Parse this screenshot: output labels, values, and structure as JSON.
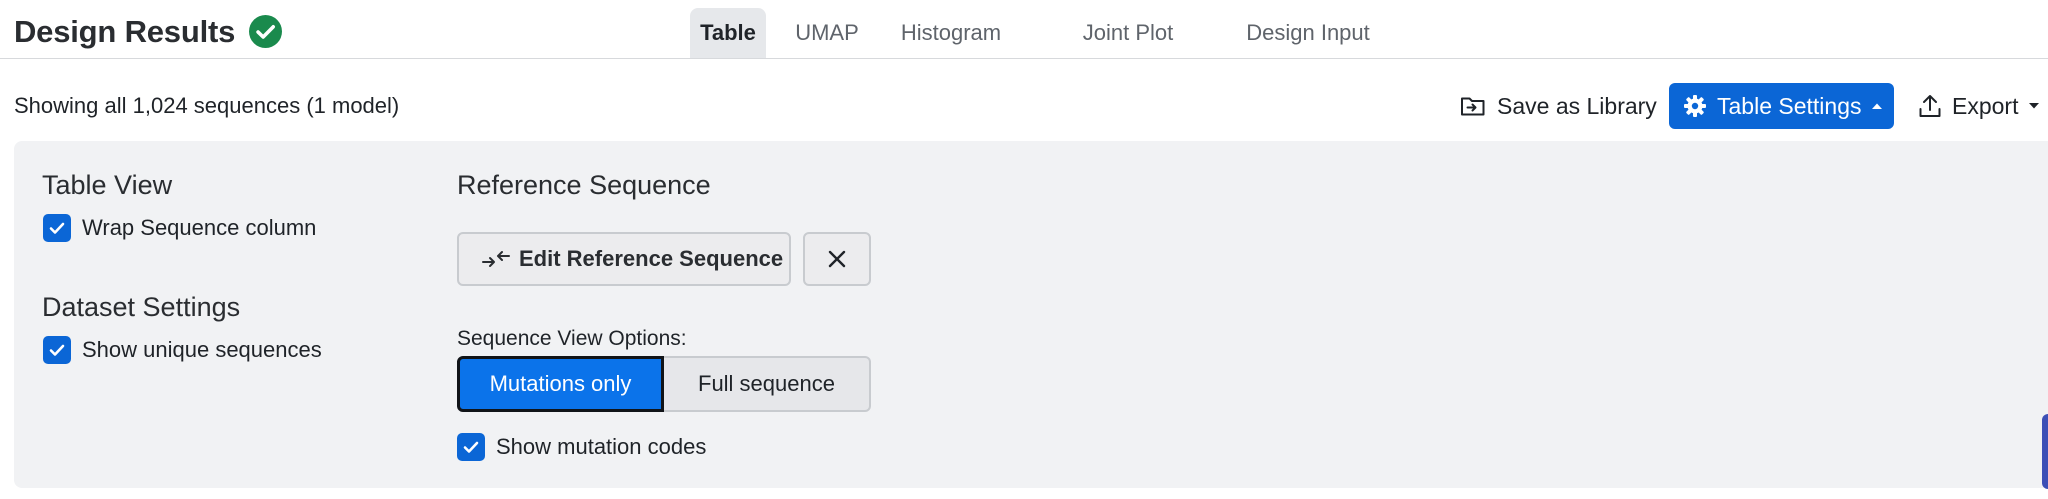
{
  "header": {
    "title": "Design Results",
    "status_icon": "check-circle-icon",
    "status_color": "#1a8a4d",
    "tabs": [
      {
        "label": "Table",
        "active": true
      },
      {
        "label": "UMAP",
        "active": false
      },
      {
        "label": "Histogram",
        "active": false
      },
      {
        "label": "Joint Plot",
        "active": false
      },
      {
        "label": "Design Input",
        "active": false
      }
    ]
  },
  "toolbar": {
    "showing_text": "Showing all 1,024 sequences (1 model)",
    "save_library_label": "Save as Library",
    "save_library_icon": "folder-save-icon",
    "table_settings_label": "Table Settings",
    "table_settings_icon": "gear-icon",
    "export_label": "Export",
    "export_icon": "upload-icon",
    "accent_color": "#0b66d6"
  },
  "settings": {
    "table_view": {
      "title": "Table View",
      "wrap_sequence": {
        "label": "Wrap Sequence column",
        "checked": true
      }
    },
    "dataset_settings": {
      "title": "Dataset Settings",
      "show_unique": {
        "label": "Show unique sequences",
        "checked": true
      }
    },
    "reference_sequence": {
      "title": "Reference Sequence",
      "edit_label": "Edit Reference Sequence",
      "edit_icon": "compare-arrows-icon",
      "clear_icon": "close-icon"
    },
    "sequence_view": {
      "label": "Sequence View Options:",
      "options": [
        {
          "label": "Mutations only",
          "selected": true
        },
        {
          "label": "Full sequence",
          "selected": false
        }
      ],
      "show_mutation_codes": {
        "label": "Show mutation codes",
        "checked": true
      }
    }
  }
}
